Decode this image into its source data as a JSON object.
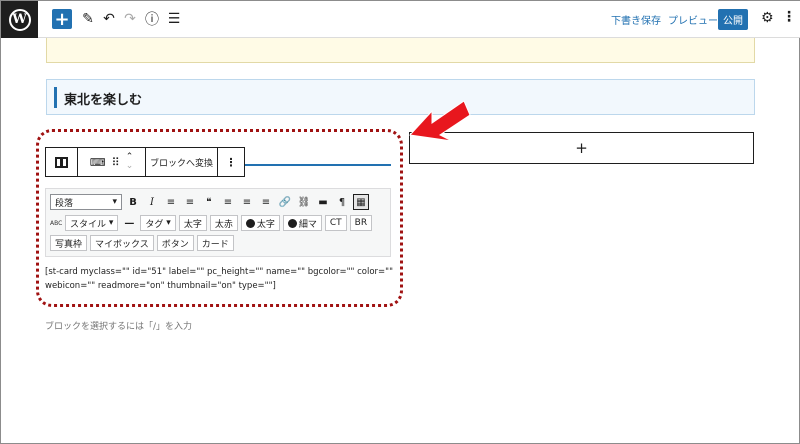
{
  "topbar": {
    "logo_letter": "W",
    "add_symbol": "+",
    "pen_icon": "✎",
    "undo_icon": "↶",
    "redo_icon": "↷",
    "info_icon": "ⓘ",
    "list_icon": "☰",
    "save_draft_label": "下書き保存",
    "preview_label": "プレビュー",
    "publish_label": "公開",
    "settings_icon": "⚙",
    "more_icon": "⋮"
  },
  "content": {
    "heading_text": "東北を楽しむ",
    "add_block_symbol": "+",
    "placeholder_hint": "ブロックを選択するには「/」を入力"
  },
  "block_toolbar": {
    "transform_label": "ブロックへ変換",
    "more_symbol": "⋮",
    "drag_symbol": "⠿",
    "up_symbol": "⌃",
    "down_symbol": "⌄",
    "keyboard_symbol": "⌨"
  },
  "classic_toolbar": {
    "format_select_value": "段落",
    "row1_icons": [
      "B",
      "I",
      "≡",
      "≡",
      "❝",
      "≡",
      "≡",
      "≡",
      "🔗",
      "⛓",
      "▬",
      "¶",
      "▦"
    ],
    "style_select_value": "スタイル",
    "hr_symbol": "—",
    "tag_select_value": "タグ",
    "row2_buttons": [
      "太字",
      "太赤"
    ],
    "row2_circle_buttons": [
      "太字",
      "細マ"
    ],
    "row2_end_buttons": [
      "CT",
      "BR"
    ],
    "row3_buttons": [
      "写真枠",
      "マイボックス",
      "ボタン",
      "カード"
    ]
  },
  "shortcode_text": "[st-card myclass=\"\" id=\"51\" label=\"\" pc_height=\"\" name=\"\" bgcolor=\"\" color=\"\" webicon=\"\" readmore=\"on\" thumbnail=\"on\" type=\"\"]",
  "colors": {
    "accent": "#2271b1",
    "highlight": "#a01212",
    "arrow": "#e8171e"
  }
}
